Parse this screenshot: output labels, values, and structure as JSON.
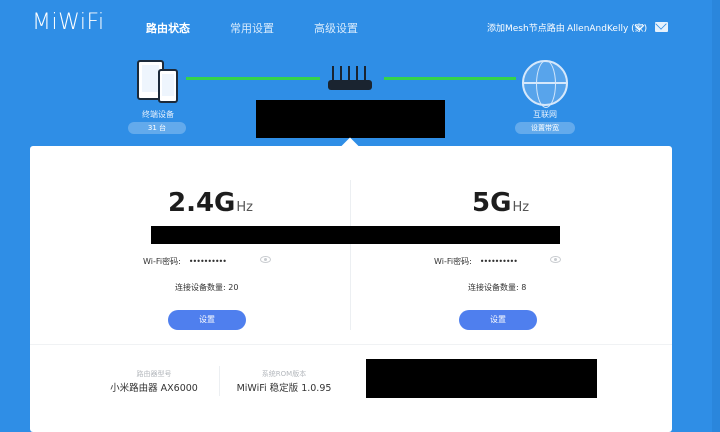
{
  "header": {
    "logo": "MiWiFi",
    "nav": [
      {
        "label": "路由状态",
        "active": true
      },
      {
        "label": "常用设置",
        "active": false
      },
      {
        "label": "高级设置",
        "active": false
      }
    ],
    "mesh_link": "添加Mesh节点路由",
    "user": "AllenAndKelly (家)"
  },
  "topology": {
    "devices": {
      "label": "终端设备",
      "count": "31 台"
    },
    "internet": {
      "label": "互联网",
      "pill": "设置带宽"
    }
  },
  "bands": [
    {
      "name": "2.4G",
      "unit": "Hz",
      "pw_label": "Wi-Fi密码:",
      "pw_dots": "••••••••••",
      "count_text": "连接设备数量: 20",
      "button": "设置"
    },
    {
      "name": "5G",
      "unit": "Hz",
      "pw_label": "Wi-Fi密码:",
      "pw_dots": "••••••••••",
      "count_text": "连接设备数量: 8",
      "button": "设置"
    }
  ],
  "info": {
    "model_label": "路由器型号",
    "model_value": "小米路由器 AX6000",
    "rom_label": "系统ROM版本",
    "rom_value": "MiWiFi 稳定版 1.0.95"
  },
  "colors": {
    "background": "#2f8ee6",
    "link_line": "#35d34a",
    "button": "#4f7fee"
  }
}
